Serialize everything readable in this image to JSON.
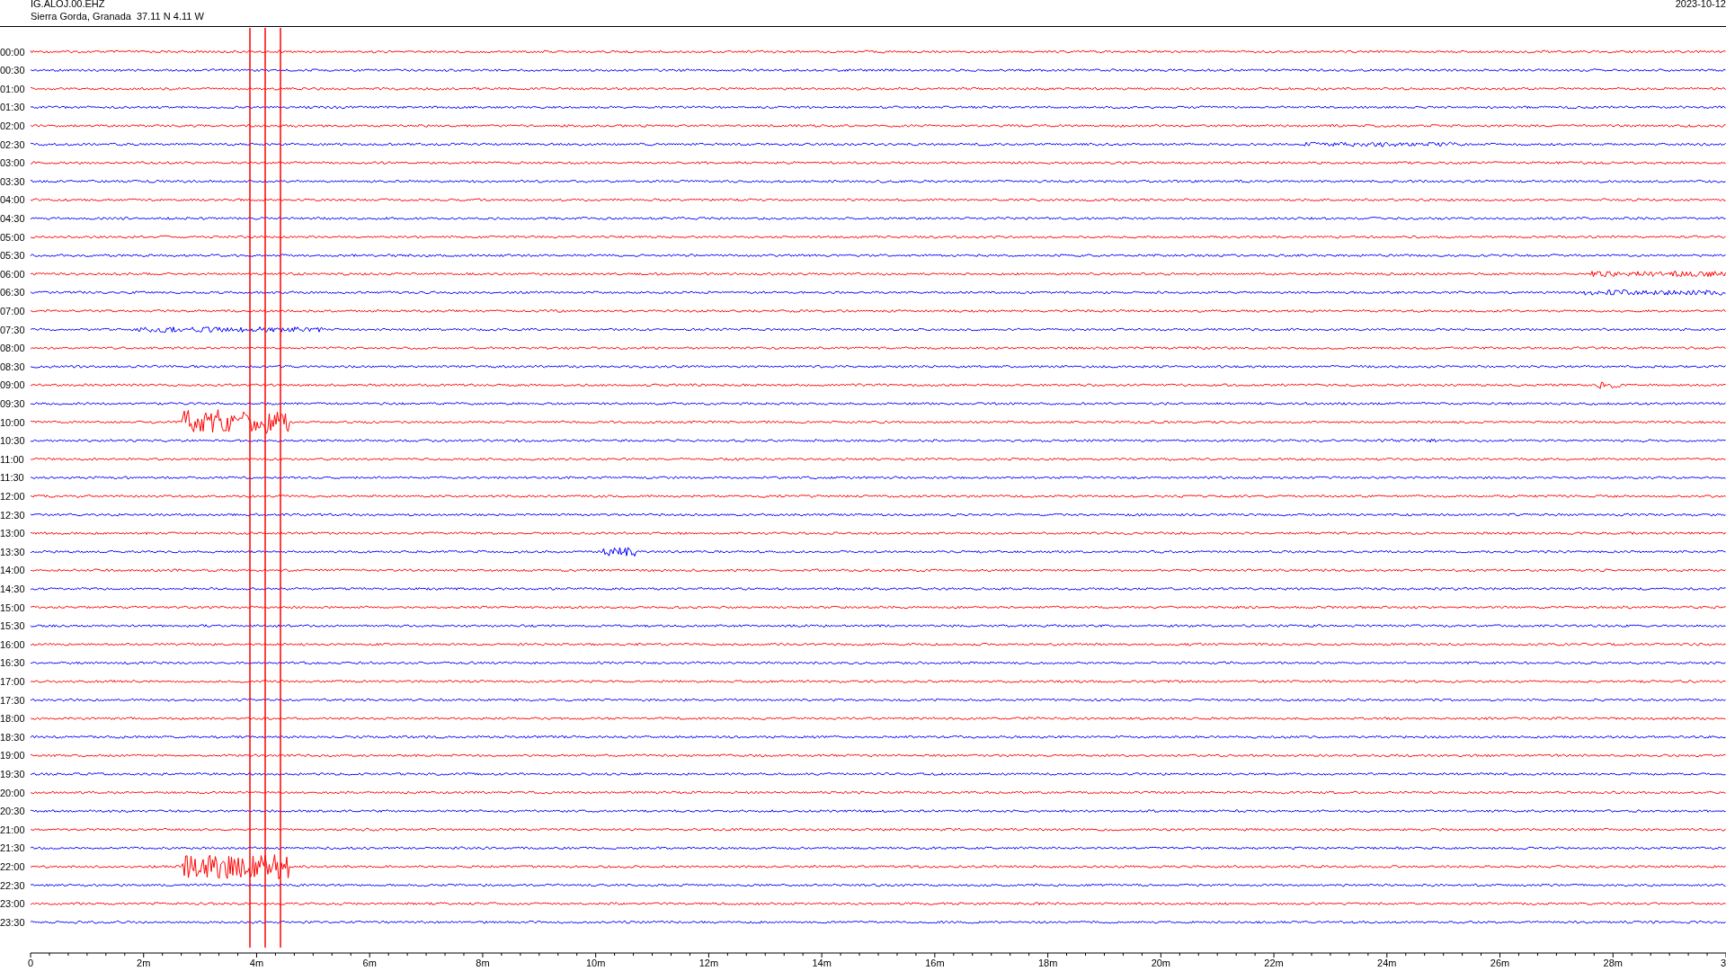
{
  "header": {
    "station": "IG.ALOJ.00.EHZ",
    "location": "Sierra Gorda, Granada  37.11 N 4.11 W",
    "date": "2023-10-12"
  },
  "rows": [
    {
      "label": "00:00",
      "color": "#ff0000"
    },
    {
      "label": "00:30",
      "color": "#0000ff"
    },
    {
      "label": "01:00",
      "color": "#ff0000"
    },
    {
      "label": "01:30",
      "color": "#0000ff"
    },
    {
      "label": "02:00",
      "color": "#ff0000"
    },
    {
      "label": "02:30",
      "color": "#0000ff"
    },
    {
      "label": "03:00",
      "color": "#ff0000"
    },
    {
      "label": "03:30",
      "color": "#0000ff"
    },
    {
      "label": "04:00",
      "color": "#ff0000"
    },
    {
      "label": "04:30",
      "color": "#0000ff"
    },
    {
      "label": "05:00",
      "color": "#ff0000"
    },
    {
      "label": "05:30",
      "color": "#0000ff"
    },
    {
      "label": "06:00",
      "color": "#ff0000"
    },
    {
      "label": "06:30",
      "color": "#0000ff"
    },
    {
      "label": "07:00",
      "color": "#ff0000"
    },
    {
      "label": "07:30",
      "color": "#0000ff"
    },
    {
      "label": "08:00",
      "color": "#ff0000"
    },
    {
      "label": "08:30",
      "color": "#0000ff"
    },
    {
      "label": "09:00",
      "color": "#ff0000"
    },
    {
      "label": "09:30",
      "color": "#0000ff"
    },
    {
      "label": "10:00",
      "color": "#ff0000"
    },
    {
      "label": "10:30",
      "color": "#0000ff"
    },
    {
      "label": "11:00",
      "color": "#ff0000"
    },
    {
      "label": "11:30",
      "color": "#0000ff"
    },
    {
      "label": "12:00",
      "color": "#ff0000"
    },
    {
      "label": "12:30",
      "color": "#0000ff"
    },
    {
      "label": "13:00",
      "color": "#ff0000"
    },
    {
      "label": "13:30",
      "color": "#0000ff"
    },
    {
      "label": "14:00",
      "color": "#ff0000"
    },
    {
      "label": "14:30",
      "color": "#0000ff"
    },
    {
      "label": "15:00",
      "color": "#ff0000"
    },
    {
      "label": "15:30",
      "color": "#0000ff"
    },
    {
      "label": "16:00",
      "color": "#ff0000"
    },
    {
      "label": "16:30",
      "color": "#0000ff"
    },
    {
      "label": "17:00",
      "color": "#ff0000"
    },
    {
      "label": "17:30",
      "color": "#0000ff"
    },
    {
      "label": "18:00",
      "color": "#ff0000"
    },
    {
      "label": "18:30",
      "color": "#0000ff"
    },
    {
      "label": "19:00",
      "color": "#ff0000"
    },
    {
      "label": "19:30",
      "color": "#0000ff"
    },
    {
      "label": "20:00",
      "color": "#ff0000"
    },
    {
      "label": "20:30",
      "color": "#0000ff"
    },
    {
      "label": "21:00",
      "color": "#ff0000"
    },
    {
      "label": "21:30",
      "color": "#0000ff"
    },
    {
      "label": "22:00",
      "color": "#ff0000"
    },
    {
      "label": "22:30",
      "color": "#0000ff"
    },
    {
      "label": "23:00",
      "color": "#ff0000"
    },
    {
      "label": "23:30",
      "color": "#0000ff"
    }
  ],
  "axis_labels": [
    "0",
    "2m",
    "4m",
    "6m",
    "8m",
    "10m",
    "12m",
    "14m",
    "16m",
    "18m",
    "20m",
    "22m",
    "24m",
    "26m",
    "28m",
    "3"
  ]
}
